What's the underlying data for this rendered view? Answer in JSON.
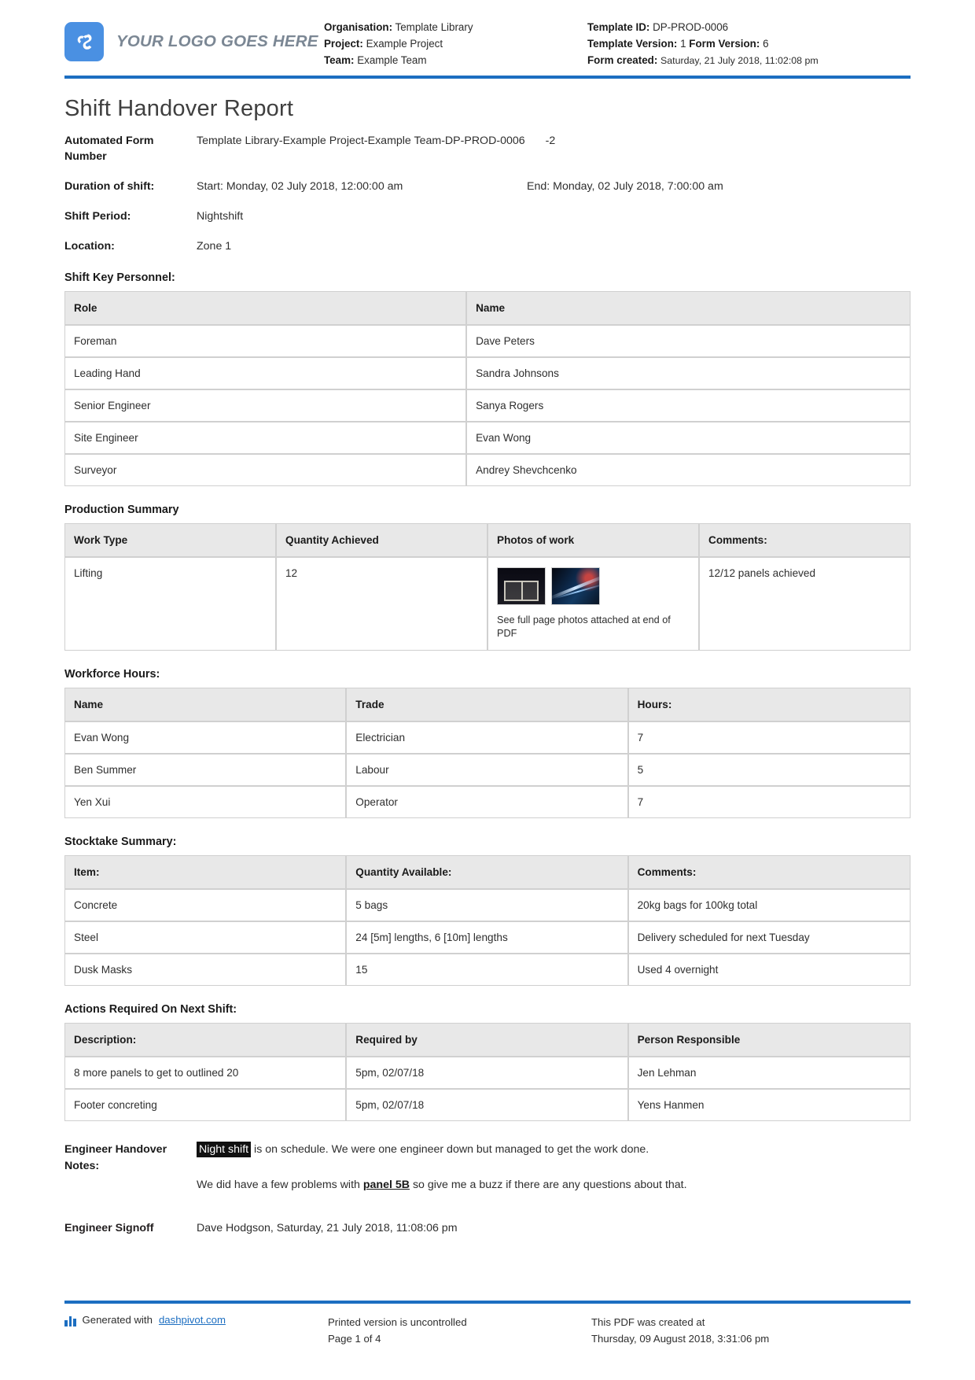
{
  "header": {
    "logo_text": "YOUR LOGO GOES HERE",
    "left": [
      {
        "label": "Organisation:",
        "value": "Template Library"
      },
      {
        "label": "Project:",
        "value": "Example Project"
      },
      {
        "label": "Team:",
        "value": "Example Team"
      }
    ],
    "right": {
      "template_id_label": "Template ID:",
      "template_id_value": "DP-PROD-0006",
      "template_version_label": "Template Version:",
      "template_version_value": "1",
      "form_version_label": "Form Version:",
      "form_version_value": "6",
      "form_created_label": "Form created:",
      "form_created_value": "Saturday, 21 July 2018, 11:02:08 pm"
    },
    "accent_color": "#1c6ec1"
  },
  "title": "Shift Handover Report",
  "fields": {
    "automated_form_number_label": "Automated Form Number",
    "automated_form_number_value": "Template Library-Example Project-Example Team-DP-PROD-0006",
    "automated_form_number_suffix": "-2",
    "duration_label": "Duration of shift:",
    "duration_start": "Start: Monday, 02 July 2018, 12:00:00 am",
    "duration_end": "End: Monday, 02 July 2018, 7:00:00 am",
    "shift_period_label": "Shift Period:",
    "shift_period_value": "Nightshift",
    "location_label": "Location:",
    "location_value": "Zone 1"
  },
  "shift_key_personnel": {
    "title": "Shift Key Personnel:",
    "columns": [
      "Role",
      "Name"
    ],
    "rows": [
      [
        "Foreman",
        "Dave Peters"
      ],
      [
        "Leading Hand",
        "Sandra Johnsons"
      ],
      [
        "Senior Engineer",
        "Sanya Rogers"
      ],
      [
        "Site Engineer",
        "Evan Wong"
      ],
      [
        "Surveyor",
        "Andrey Shevchcenko"
      ]
    ]
  },
  "production_summary": {
    "title": "Production Summary",
    "columns": [
      "Work Type",
      "Quantity Achieved",
      "Photos of work",
      "Comments:"
    ],
    "row": {
      "work_type": "Lifting",
      "quantity_achieved": "12",
      "photo_caption": "See full page photos attached at end of PDF",
      "comments": "12/12 panels achieved"
    }
  },
  "workforce_hours": {
    "title": "Workforce Hours:",
    "columns": [
      "Name",
      "Trade",
      "Hours:"
    ],
    "rows": [
      [
        "Evan Wong",
        "Electrician",
        "7"
      ],
      [
        "Ben Summer",
        "Labour",
        "5"
      ],
      [
        "Yen Xui",
        "Operator",
        "7"
      ]
    ]
  },
  "stocktake_summary": {
    "title": "Stocktake Summary:",
    "columns": [
      "Item:",
      "Quantity Available:",
      "Comments:"
    ],
    "rows": [
      [
        "Concrete",
        "5 bags",
        "20kg bags for 100kg total"
      ],
      [
        "Steel",
        "24 [5m] lengths, 6 [10m] lengths",
        "Delivery scheduled for next Tuesday"
      ],
      [
        "Dusk Masks",
        "15",
        "Used 4 overnight"
      ]
    ]
  },
  "actions_required": {
    "title": "Actions Required On Next Shift:",
    "columns": [
      "Description:",
      "Required by",
      "Person Responsible"
    ],
    "rows": [
      [
        "8 more panels to get to outlined 20",
        "5pm, 02/07/18",
        "Jen Lehman"
      ],
      [
        "Footer concreting",
        "5pm, 02/07/18",
        "Yens Hanmen"
      ]
    ]
  },
  "handover_notes": {
    "label": "Engineer Handover Notes:",
    "p1_highlight": "Night shift",
    "p1_rest": " is on schedule. We were one engineer down but managed to get the work done.",
    "p2_before": "We did have a few problems with ",
    "p2_emphasis": "panel 5B",
    "p2_after": " so give me a buzz if there are any questions about that."
  },
  "signoff": {
    "label": "Engineer Signoff",
    "value": "Dave Hodgson, Saturday, 21 July 2018, 11:08:06 pm"
  },
  "footer": {
    "generated_with": "Generated with",
    "generated_link": "dashpivot.com",
    "printed_line1": "Printed version is uncontrolled",
    "printed_line2": "Page 1 of 4",
    "created_line1": "This PDF was created at",
    "created_line2": "Thursday, 09 August 2018, 3:31:06 pm"
  }
}
